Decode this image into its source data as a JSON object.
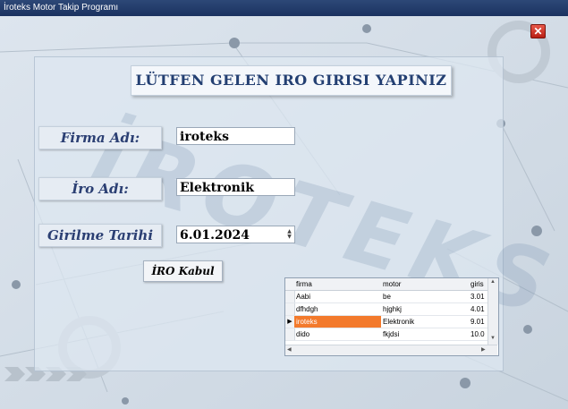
{
  "window": {
    "title": "İroteks Motor Takip Programı"
  },
  "icons": {
    "close": "close-icon"
  },
  "form": {
    "heading": "LÜTFEN GELEN IRO GIRISI YAPINIZ",
    "firma_label": "Firma Adı:",
    "firma_value": "iroteks",
    "iro_label": "İro Adı:",
    "iro_value": "Elektronik",
    "tarih_label": "Girilme Tarihi",
    "tarih_value": "6.01.2024",
    "accept_button": "İRO Kabul"
  },
  "watermark": "İROTEKS",
  "grid": {
    "columns": [
      "firma",
      "motor",
      "giris"
    ],
    "rows": [
      {
        "firma": "Aabi",
        "motor": "be",
        "giris": "3.01"
      },
      {
        "firma": "dfhdgh",
        "motor": "hjghkj",
        "giris": "4.01"
      },
      {
        "firma": "iroteks",
        "motor": "Elektronik",
        "giris": "9.01",
        "selected": true
      },
      {
        "firma": "dido",
        "motor": "fkjdsi",
        "giris": "10.0"
      }
    ]
  },
  "colors": {
    "selected_row": "#f37a2c",
    "titlebar": "#1b3260",
    "label_text": "#2b3f73"
  }
}
